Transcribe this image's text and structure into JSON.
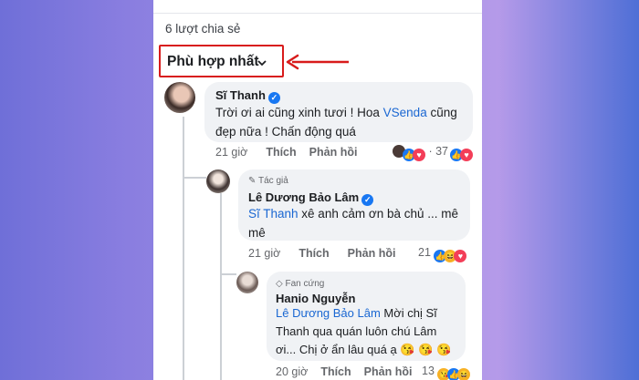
{
  "share_count": "6 lượt chia sẻ",
  "sort_label": "Phù hợp nhất",
  "colors": {
    "highlight_box": "#d81b1b",
    "arrow": "#d81b1b",
    "link": "#1a67d2"
  },
  "comments": [
    {
      "author": "Sĩ Thanh",
      "line1_pre": "Trời ơi ai cũng xinh tươi ! Hoa ",
      "mention": "VSenda",
      "line1_post": " cũng",
      "line2": "đẹp nữa ! Chấn động quá",
      "time": "21 giờ",
      "like": "Thích",
      "reply": "Phản hồi",
      "reaction_count": "37"
    },
    {
      "badge": "Tác giả",
      "author": "Lê Dương Bảo Lâm",
      "mention": "Sĩ Thanh",
      "text_post": " xê anh cảm ơn bà chủ ... mê",
      "line2": "mê",
      "time": "21 giờ",
      "like": "Thích",
      "reply": "Phản hồi",
      "reaction_count": "21"
    },
    {
      "badge": "Fan cứng",
      "author": "Hanio Nguyễn",
      "mention": "Lê Dương Bảo Lâm",
      "text_post": " Mời chị Sĩ",
      "line2": "Thanh qua quán luôn chú Lâm",
      "line3": "ơi... Chị ở ẩn lâu quá ạ",
      "time": "20 giờ",
      "like": "Thích",
      "reply": "Phản hồi",
      "reaction_count": "13"
    }
  ]
}
